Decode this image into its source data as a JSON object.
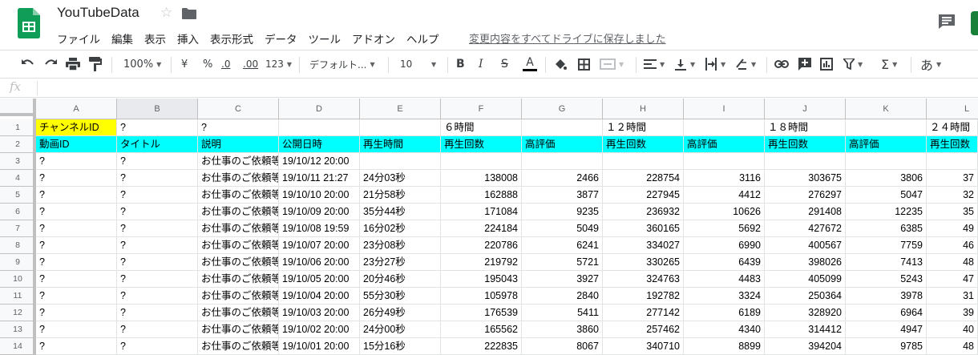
{
  "header": {
    "title": "YouTubeData",
    "saved_status": "変更内容をすべてドライブに保存しました",
    "menu": [
      "ファイル",
      "編集",
      "表示",
      "挿入",
      "表示形式",
      "データ",
      "ツール",
      "アドオン",
      "ヘルプ"
    ]
  },
  "toolbar": {
    "zoom": "100%",
    "currency": "¥",
    "percent": "%",
    "decimal_decrease": ".0",
    "decimal_increase": ".00",
    "more_formats": "123",
    "font": "デフォルト...",
    "font_size": "10",
    "bold": "B",
    "italic": "I",
    "strike": "S",
    "text_color": "A",
    "sigma": "Σ",
    "input_tools": "あ"
  },
  "formula_bar": {
    "label": "fx",
    "value": ""
  },
  "colors": {
    "accent_green": "#188038",
    "yellow_fill": "#ffff00",
    "cyan_fill": "#00ffff"
  },
  "grid": {
    "columns": [
      "A",
      "B",
      "C",
      "D",
      "E",
      "F",
      "G",
      "H",
      "I",
      "J",
      "K",
      "L"
    ],
    "selected_column": "B",
    "rows": [
      {
        "num": "1",
        "cells": [
          "チャンネルID",
          "?",
          "?",
          "",
          "",
          "６時間",
          "",
          "１２時間",
          "",
          "１８時間",
          "",
          "２４時間"
        ]
      },
      {
        "num": "2",
        "cells": [
          "動画ID",
          "タイトル",
          "説明",
          "公開日時",
          "再生時間",
          "再生回数",
          "高評価",
          "再生回数",
          "高評価",
          "再生回数",
          "高評価",
          "再生回数"
        ]
      },
      {
        "num": "3",
        "cells": [
          "?",
          "?",
          "お仕事のご依頼等",
          "19/10/12 20:00",
          "",
          "",
          "",
          "",
          "",
          "",
          "",
          ""
        ]
      },
      {
        "num": "4",
        "cells": [
          "?",
          "?",
          "お仕事のご依頼等",
          "19/10/11 21:27",
          "24分03秒",
          "138008",
          "2466",
          "228754",
          "3116",
          "303675",
          "3806",
          "37"
        ]
      },
      {
        "num": "5",
        "cells": [
          "?",
          "?",
          "お仕事のご依頼等",
          "19/10/10 20:00",
          "21分58秒",
          "162888",
          "3877",
          "227945",
          "4412",
          "276297",
          "5047",
          "32"
        ]
      },
      {
        "num": "6",
        "cells": [
          "?",
          "?",
          "お仕事のご依頼等",
          "19/10/09 20:00",
          "35分44秒",
          "171084",
          "9235",
          "236932",
          "10626",
          "291408",
          "12235",
          "35"
        ]
      },
      {
        "num": "7",
        "cells": [
          "?",
          "?",
          "お仕事のご依頼等",
          "19/10/08 19:59",
          "16分02秒",
          "224184",
          "5049",
          "360165",
          "5692",
          "427672",
          "6385",
          "49"
        ]
      },
      {
        "num": "8",
        "cells": [
          "?",
          "?",
          "お仕事のご依頼等",
          "19/10/07 20:00",
          "23分08秒",
          "220786",
          "6241",
          "334027",
          "6990",
          "400567",
          "7759",
          "46"
        ]
      },
      {
        "num": "9",
        "cells": [
          "?",
          "?",
          "お仕事のご依頼等",
          "19/10/06 20:00",
          "23分27秒",
          "219792",
          "5721",
          "330265",
          "6439",
          "398026",
          "7413",
          "48"
        ]
      },
      {
        "num": "10",
        "cells": [
          "?",
          "?",
          "お仕事のご依頼等",
          "19/10/05 20:00",
          "20分46秒",
          "195043",
          "3927",
          "324763",
          "4483",
          "405099",
          "5243",
          "47"
        ]
      },
      {
        "num": "11",
        "cells": [
          "?",
          "?",
          "お仕事のご依頼等",
          "19/10/04 20:00",
          "55分30秒",
          "105978",
          "2840",
          "192782",
          "3324",
          "250364",
          "3978",
          "31"
        ]
      },
      {
        "num": "12",
        "cells": [
          "?",
          "?",
          "お仕事のご依頼等",
          "19/10/03 20:00",
          "26分49秒",
          "176539",
          "5411",
          "277142",
          "6189",
          "328920",
          "6964",
          "39"
        ]
      },
      {
        "num": "13",
        "cells": [
          "?",
          "?",
          "お仕事のご依頼等",
          "19/10/02 20:00",
          "24分00秒",
          "165562",
          "3860",
          "257462",
          "4340",
          "314412",
          "4947",
          "40"
        ]
      },
      {
        "num": "14",
        "cells": [
          "?",
          "?",
          "お仕事のご依頼等",
          "19/10/01 20:00",
          "15分16秒",
          "222835",
          "8067",
          "340710",
          "8899",
          "394204",
          "9785",
          "48"
        ]
      }
    ]
  }
}
